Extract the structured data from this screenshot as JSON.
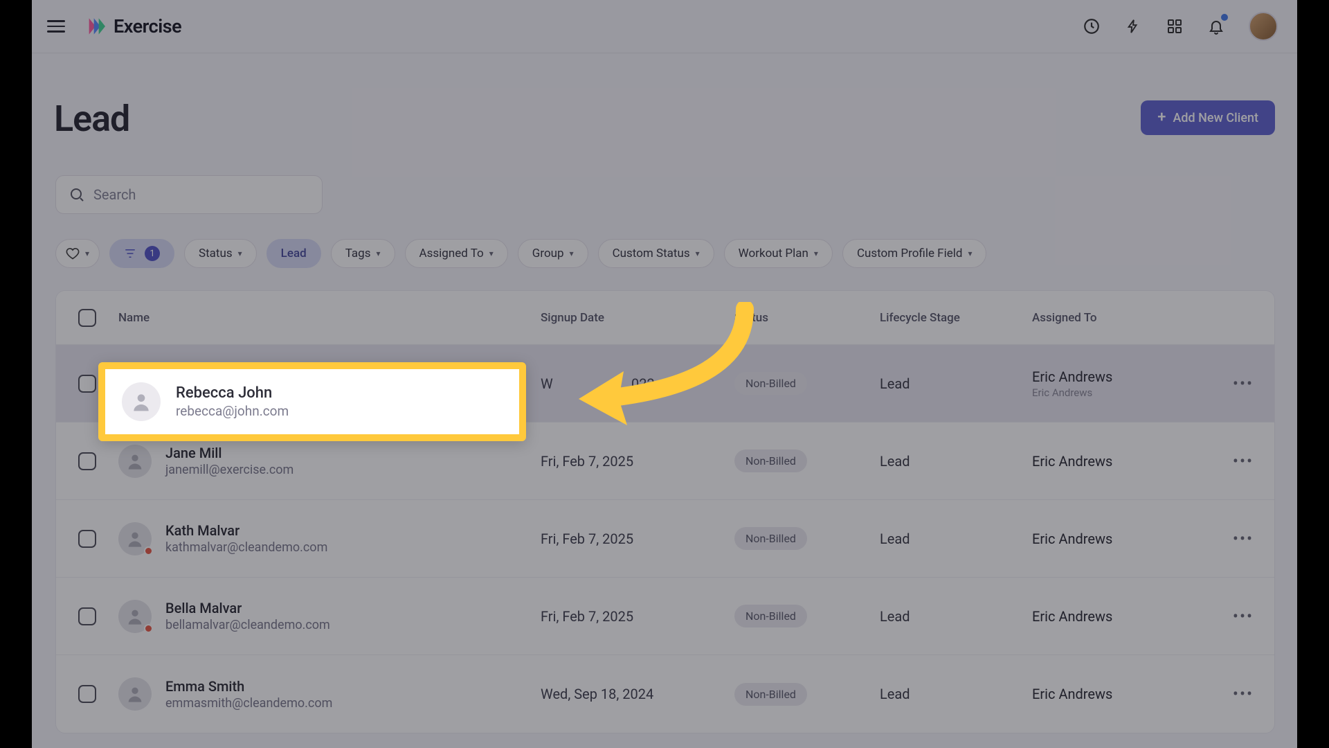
{
  "brand": "Exercise",
  "page": {
    "title": "Lead",
    "add_button": "Add New Client"
  },
  "search": {
    "placeholder": "Search"
  },
  "filters": {
    "count_badge": "1",
    "status": "Status",
    "lead": "Lead",
    "tags": "Tags",
    "assigned_to": "Assigned To",
    "group": "Group",
    "custom_status": "Custom Status",
    "workout_plan": "Workout Plan",
    "custom_profile_field": "Custom Profile Field"
  },
  "columns": {
    "name": "Name",
    "signup_date": "Signup Date",
    "status": "Status",
    "lifecycle_stage": "Lifecycle Stage",
    "assigned_to": "Assigned To"
  },
  "rows": [
    {
      "name": "Rebecca John",
      "email": "rebecca@john.com",
      "date_partial": "W",
      "date_suffix": "022",
      "status": "Non-Billed",
      "stage": "Lead",
      "assigned": "Eric Andrews",
      "assigned_sub": "Eric Andrews",
      "dot": false,
      "highlighted": true
    },
    {
      "name": "Jane Mill",
      "email": "janemill@exercise.com",
      "date": "Fri, Feb 7, 2025",
      "status": "Non-Billed",
      "stage": "Lead",
      "assigned": "Eric Andrews",
      "dot": false
    },
    {
      "name": "Kath Malvar",
      "email": "kathmalvar@cleandemo.com",
      "date": "Fri, Feb 7, 2025",
      "status": "Non-Billed",
      "stage": "Lead",
      "assigned": "Eric Andrews",
      "dot": true
    },
    {
      "name": "Bella Malvar",
      "email": "bellamalvar@cleandemo.com",
      "date": "Fri, Feb 7, 2025",
      "status": "Non-Billed",
      "stage": "Lead",
      "assigned": "Eric Andrews",
      "dot": true
    },
    {
      "name": "Emma Smith",
      "email": "emmasmith@cleandemo.com",
      "date": "Wed, Sep 18, 2024",
      "status": "Non-Billed",
      "stage": "Lead",
      "assigned": "Eric Andrews",
      "dot": false
    }
  ]
}
